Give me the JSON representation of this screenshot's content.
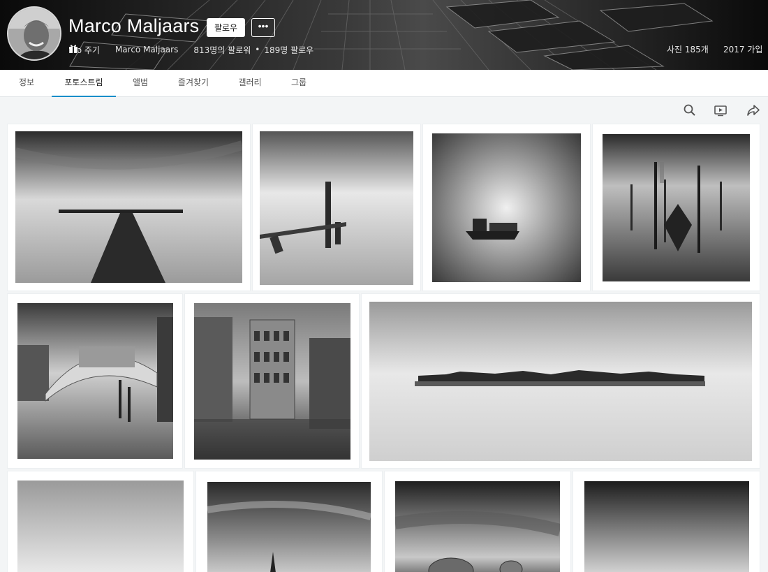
{
  "profile": {
    "name": "Marco Maljaars",
    "follow_label": "팔로우",
    "more_label": "•••",
    "pro_label": "Pro 주기",
    "username": "Marco Maljaars",
    "followers": "813명의 팔로워",
    "separator": "•",
    "following": "189명 팔로우",
    "photos": "사진 185개",
    "joined": "2017 가입"
  },
  "tabs": [
    {
      "label": "정보"
    },
    {
      "label": "포토스트림"
    },
    {
      "label": "앨범"
    },
    {
      "label": "즐겨찾기"
    },
    {
      "label": "갤러리"
    },
    {
      "label": "그룹"
    }
  ],
  "active_tab": "포토스트림",
  "toolbar": {
    "icons": [
      "search-icon",
      "slideshow-icon",
      "share-icon"
    ]
  },
  "photos": [
    {
      "subject": "pier"
    },
    {
      "subject": "wooden-poles"
    },
    {
      "subject": "boat"
    },
    {
      "subject": "gondola"
    },
    {
      "subject": "rialto-bridge"
    },
    {
      "subject": "palazzo"
    },
    {
      "subject": "island"
    },
    {
      "subject": "fog"
    },
    {
      "subject": "tree"
    },
    {
      "subject": "hay-bales"
    },
    {
      "subject": "gradient-sky"
    }
  ],
  "colors": {
    "accent": "#0a8ec9",
    "page_bg": "#f3f5f6",
    "header_bg": "#111111"
  }
}
